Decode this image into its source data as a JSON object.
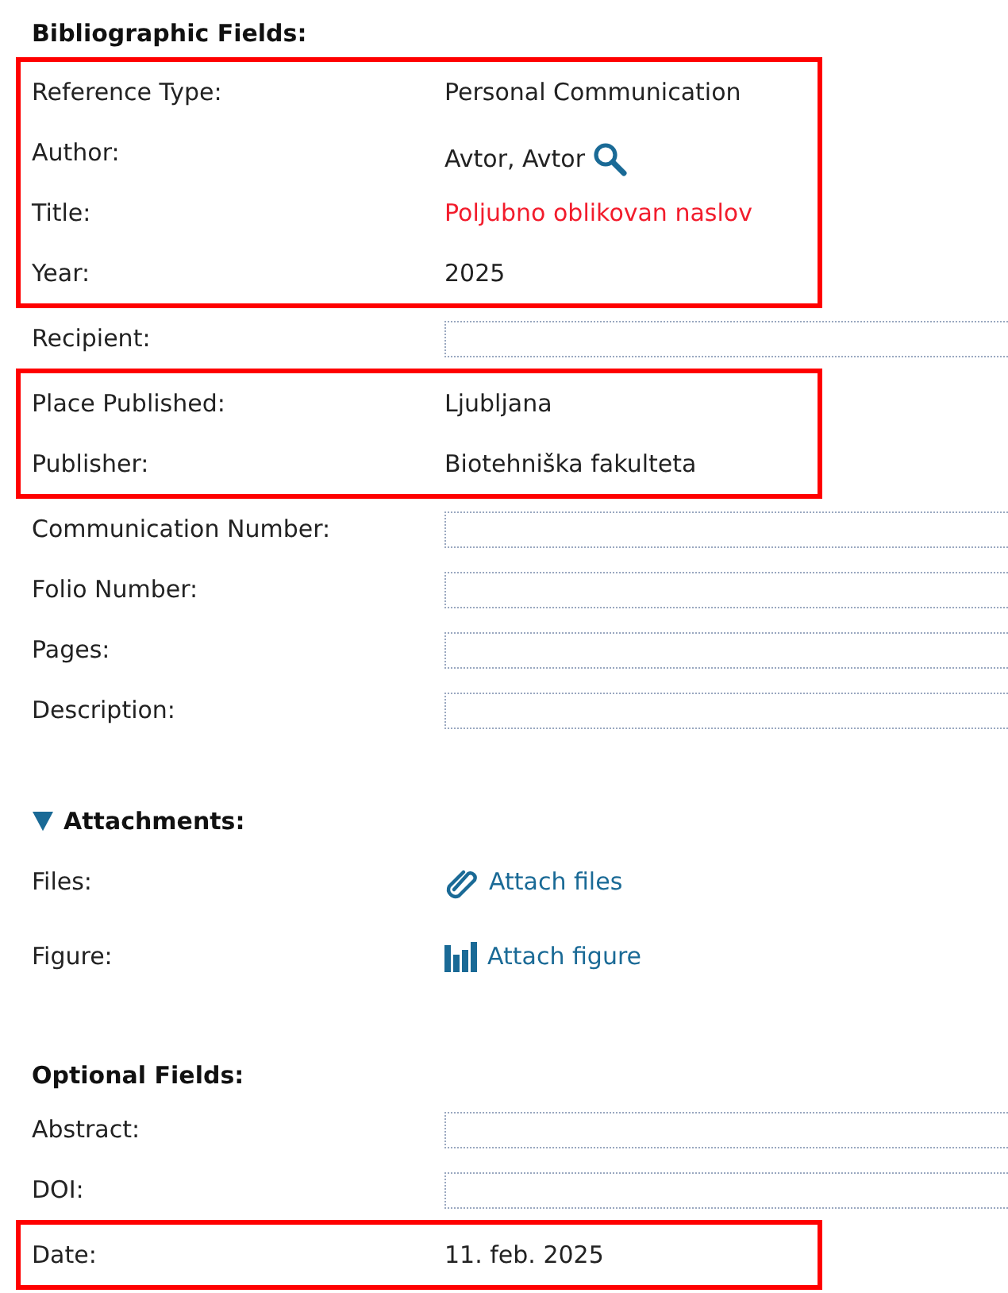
{
  "sections": [
    {
      "title": "Bibliographic Fields:",
      "kind": "fields",
      "items": [
        {
          "kind": "highlight",
          "rows": [
            {
              "label": "Reference Type:",
              "kind": "value",
              "value": "Personal Communication",
              "error": false
            },
            {
              "label": "Author:",
              "kind": "lookup",
              "value": "Avtor, Avtor",
              "error": false
            },
            {
              "label": "Title:",
              "kind": "value",
              "value": "Poljubno oblikovan naslov",
              "error": true
            },
            {
              "label": "Year:",
              "kind": "value",
              "value": "2025",
              "error": false
            }
          ]
        },
        {
          "kind": "input",
          "label": "Recipient:"
        },
        {
          "kind": "highlight",
          "rows": [
            {
              "label": "Place Published:",
              "kind": "value",
              "value": "Ljubljana",
              "error": false
            },
            {
              "label": "Publisher:",
              "kind": "value",
              "value": "Biotehniška fakulteta",
              "error": false
            }
          ]
        },
        {
          "kind": "input",
          "label": "Communication Number:"
        },
        {
          "kind": "input",
          "label": "Folio Number:"
        },
        {
          "kind": "input",
          "label": "Pages:"
        },
        {
          "kind": "input",
          "label": "Description:"
        }
      ]
    },
    {
      "title": "Attachments:",
      "kind": "attachments",
      "expanded": true,
      "items": [
        {
          "kind": "files",
          "label": "Files:",
          "link": "Attach files"
        },
        {
          "kind": "figure",
          "label": "Figure:",
          "link": "Attach figure"
        }
      ]
    },
    {
      "title": "Optional Fields:",
      "kind": "fields",
      "items": [
        {
          "kind": "input",
          "label": "Abstract:"
        },
        {
          "kind": "input",
          "label": "DOI:"
        },
        {
          "kind": "highlight",
          "rows": [
            {
              "label": "Date:",
              "kind": "value",
              "value": "11. feb. 2025",
              "error": false
            }
          ]
        }
      ]
    }
  ]
}
